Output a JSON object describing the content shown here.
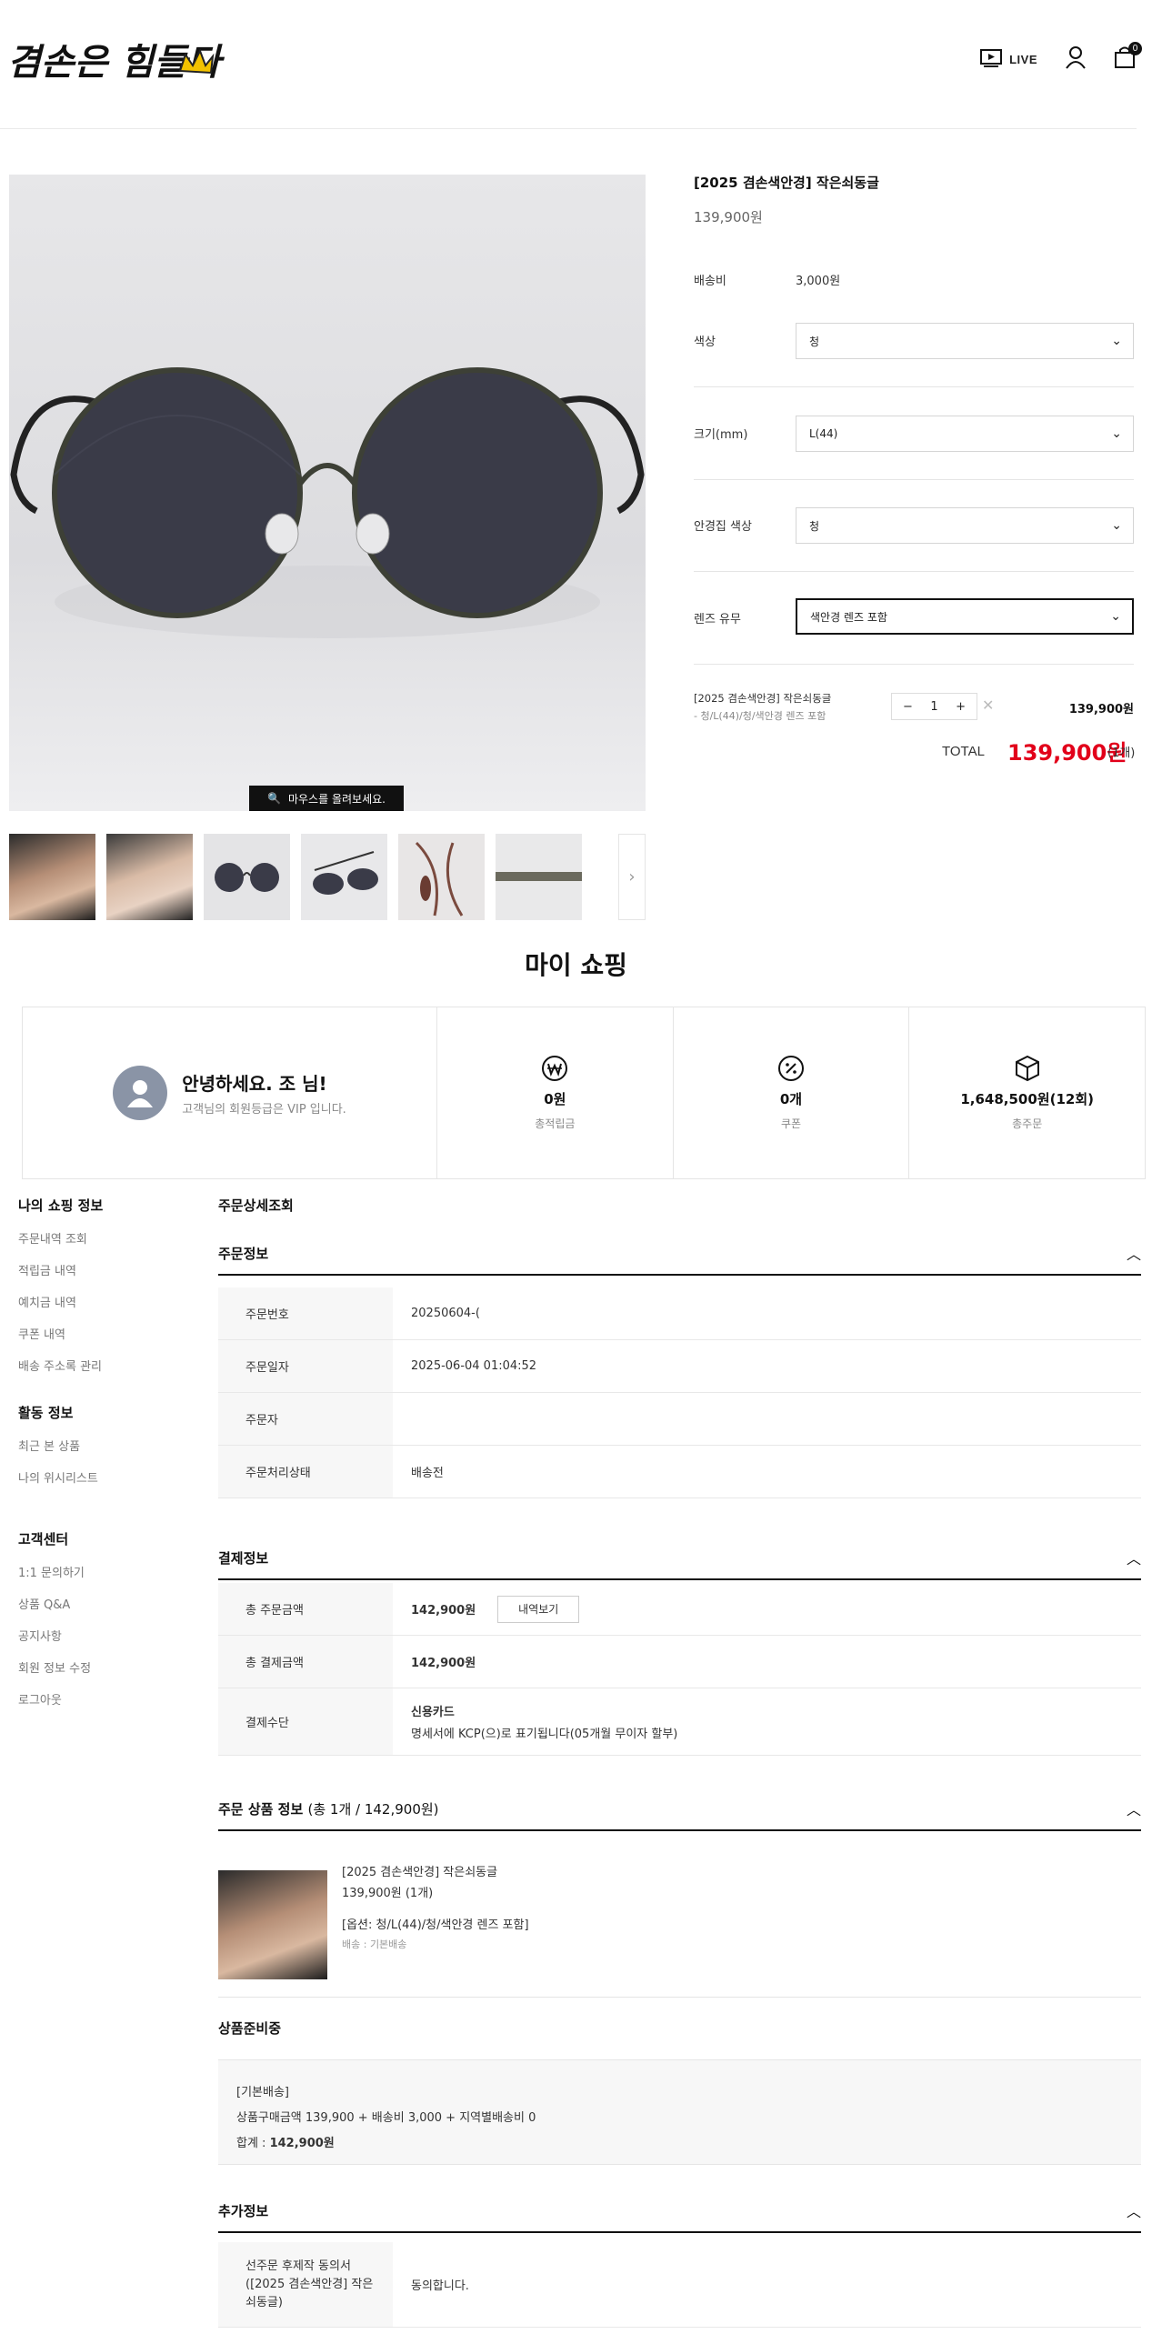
{
  "header": {
    "logo_text": "겸손은 힘들다",
    "live_label": "LIVE",
    "cart_count": "0"
  },
  "product": {
    "title": "[2025 겸손색안경] 작은쇠동글",
    "price": "139,900원",
    "hover_hint": "마우스를 올려보세요.",
    "shipping_label": "배송비",
    "shipping_value": "3,000원",
    "options": [
      {
        "label": "색상",
        "value": "청"
      },
      {
        "label": "크기(mm)",
        "value": "L(44)"
      },
      {
        "label": "안경집 색상",
        "value": "청"
      },
      {
        "label": "렌즈 유무",
        "value": "색안경 렌즈 포함"
      }
    ],
    "selected_item": {
      "name": "[2025 겸손색안경] 작은쇠동글",
      "options": "- 청/L(44)/청/색안경 렌즈 포함",
      "quantity": "1",
      "price": "139,900원"
    },
    "total_label": "TOTAL",
    "total_price": "139,900원",
    "total_count": "(1개)"
  },
  "my_shopping": {
    "title": "마이 쇼핑",
    "greeting": "안녕하세요. 조      님!",
    "grade_text": "고객님의 회원등급은 VIP 입니다.",
    "stats": [
      {
        "icon": "won-icon",
        "value": "0원",
        "label": "총적립금"
      },
      {
        "icon": "percent-icon",
        "value": "0개",
        "label": "쿠폰"
      },
      {
        "icon": "box-icon",
        "value": "1,648,500원(12회)",
        "label": "총주문"
      }
    ]
  },
  "sidebar": {
    "sections": [
      {
        "title": "나의 쇼핑 정보",
        "items": [
          "주문내역 조회",
          "적립금 내역",
          "예치금 내역",
          "쿠폰 내역",
          "배송 주소록 관리"
        ]
      },
      {
        "title": "활동 정보",
        "items": [
          "최근 본 상품",
          "나의 위시리스트"
        ]
      },
      {
        "title": "고객센터",
        "items": [
          "1:1 문의하기",
          "상품 Q&A",
          "공지사항",
          "회원 정보 수정",
          "로그아웃"
        ]
      }
    ]
  },
  "order": {
    "page_title": "주문상세조회",
    "info_title": "주문정보",
    "info_rows": [
      {
        "label": "주문번호",
        "value": "20250604-("
      },
      {
        "label": "주문일자",
        "value": "2025-06-04 01:04:52"
      },
      {
        "label": "주문자",
        "value": ""
      },
      {
        "label": "주문처리상태",
        "value": "배송전"
      }
    ],
    "payment_title": "결제정보",
    "payment_rows": {
      "total_order_label": "총 주문금액",
      "total_order_value": "142,900원",
      "detail_button": "내역보기",
      "total_paid_label": "총 결제금액",
      "total_paid_value": "142,900원",
      "method_label": "결제수단",
      "method_value": "신용카드",
      "method_note": "명세서에 KCP(으)로 표기됩니다(05개월 무이자 할부)"
    },
    "items_title": "주문 상품 정보",
    "items_sub": "(총 1개 / 142,900원)",
    "item": {
      "name": "[2025 겸손색안경] 작은쇠동글",
      "price_qty": "139,900원 (1개)",
      "options": "[옵션: 청/L(44)/청/색안경 렌즈 포함]",
      "delivery": "배송 : 기본배송"
    },
    "prep_title": "상품준비중",
    "prep_box": {
      "type": "[기본배송]",
      "calc": "상품구매금액 139,900 + 배송비 3,000 + 지역별배송비 0",
      "sum_label": "합계 : ",
      "sum_value": "142,900원"
    },
    "extra_title": "추가정보",
    "extra_row": {
      "label": "선주문 후제작 동의서 ([2025 겸손색안경] 작은쇠동글)",
      "value": "동의합니다."
    }
  }
}
